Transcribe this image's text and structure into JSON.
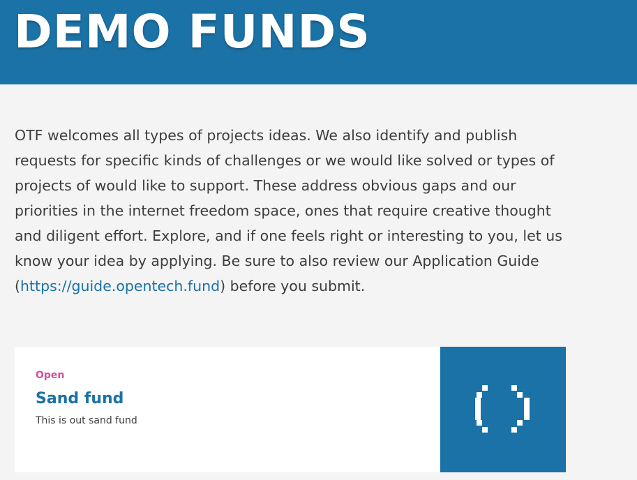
{
  "header": {
    "title": "DEMO FUNDS",
    "background_color": "#1a72a6"
  },
  "intro": {
    "text_before_link": "OTF welcomes all types of projects ideas. We also identify and publish requests for specific kinds of challenges or we would like solved or types of projects of would like to support. These address obvious gaps and our priorities in the internet freedom space, ones that require creative thought and diligent effort. Explore, and if one feels right or interesting to you, let us know your idea by applying. Be sure to also review our Application Guide (",
    "link_text": "https://guide.opentech.fund",
    "text_after_link": ") before you submit."
  },
  "funds": [
    {
      "status": "Open",
      "title": "Sand fund",
      "description": "This is out sand fund",
      "thumbnail_icon": "pixel-brackets-icon"
    }
  ],
  "colors": {
    "accent": "#1a72a6",
    "status_open": "#d44e9a",
    "page_background": "#f4f4f4"
  }
}
